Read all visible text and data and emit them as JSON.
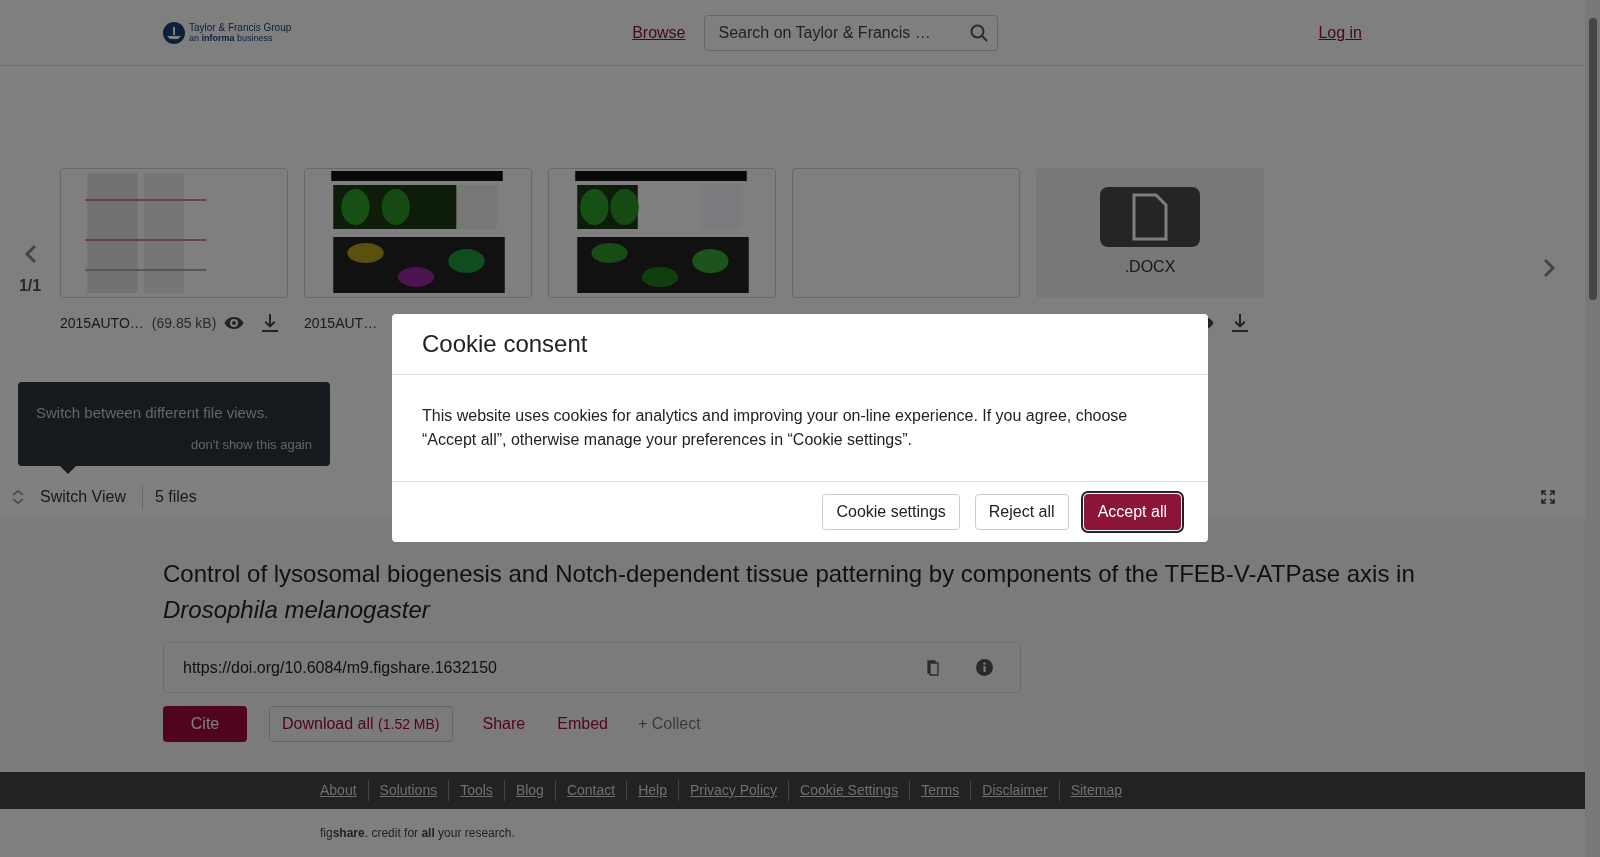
{
  "header": {
    "logo_name": "Taylor & Francis Group",
    "logo_tagline": "an **informa** business",
    "browse": "Browse",
    "search": {
      "placeholder": "Search on Taylor & Francis …"
    },
    "login": "Log in"
  },
  "carousel": {
    "page": "1/1",
    "files": [
      {
        "thumbnail": {
          "kind": "picture"
        },
        "name": "2015AUTO…",
        "size": "(69.85 kB)",
        "actions": true
      },
      {
        "thumbnail": {
          "kind": "picture"
        },
        "name": "2015AUT…"
      },
      {
        "thumbnail": {
          "kind": "picture"
        }
      },
      {
        "thumbnail": {
          "kind": "blank"
        }
      },
      {
        "thumbnail": {
          "kind": "file",
          "label": ".DOCX"
        },
        "actions": true
      }
    ]
  },
  "tooltip": {
    "text": "Switch between different file views.",
    "dismiss": "don't show this again"
  },
  "toolbar": {
    "switch_view": "Switch View",
    "count": "5 files"
  },
  "title": "Control of lysosomal biogenesis and Notch-dependent tissue patterning by components of the TFEB-V-ATPase axis in *Drosophila melanogaster*",
  "doi": "https://doi.org/10.6084/m9.figshare.1632150",
  "actions": {
    "cite": "Cite",
    "download": "Download all",
    "download_size": "(1.52 MB)",
    "share": "Share",
    "embed": "Embed",
    "collect": "+ Collect"
  },
  "footer": {
    "links": [
      "About",
      "Solutions",
      "Tools",
      "Blog",
      "Contact",
      "Help",
      "Privacy Policy",
      "Cookie Settings",
      "Terms",
      "Disclaimer",
      "Sitemap"
    ],
    "tagline": "fig**share**. credit for **all** your research."
  },
  "cookie": {
    "title": "Cookie consent",
    "text": "This website uses cookies for analytics and improving your on-line experience. If you agree, choose “Accept all”, otherwise manage your preferences in “Cookie settings”.",
    "buttons": [
      {
        "label": "Cookie settings",
        "kind": "secondary"
      },
      {
        "label": "Reject all",
        "kind": "secondary"
      },
      {
        "label": "Accept all",
        "kind": "primary"
      }
    ]
  }
}
